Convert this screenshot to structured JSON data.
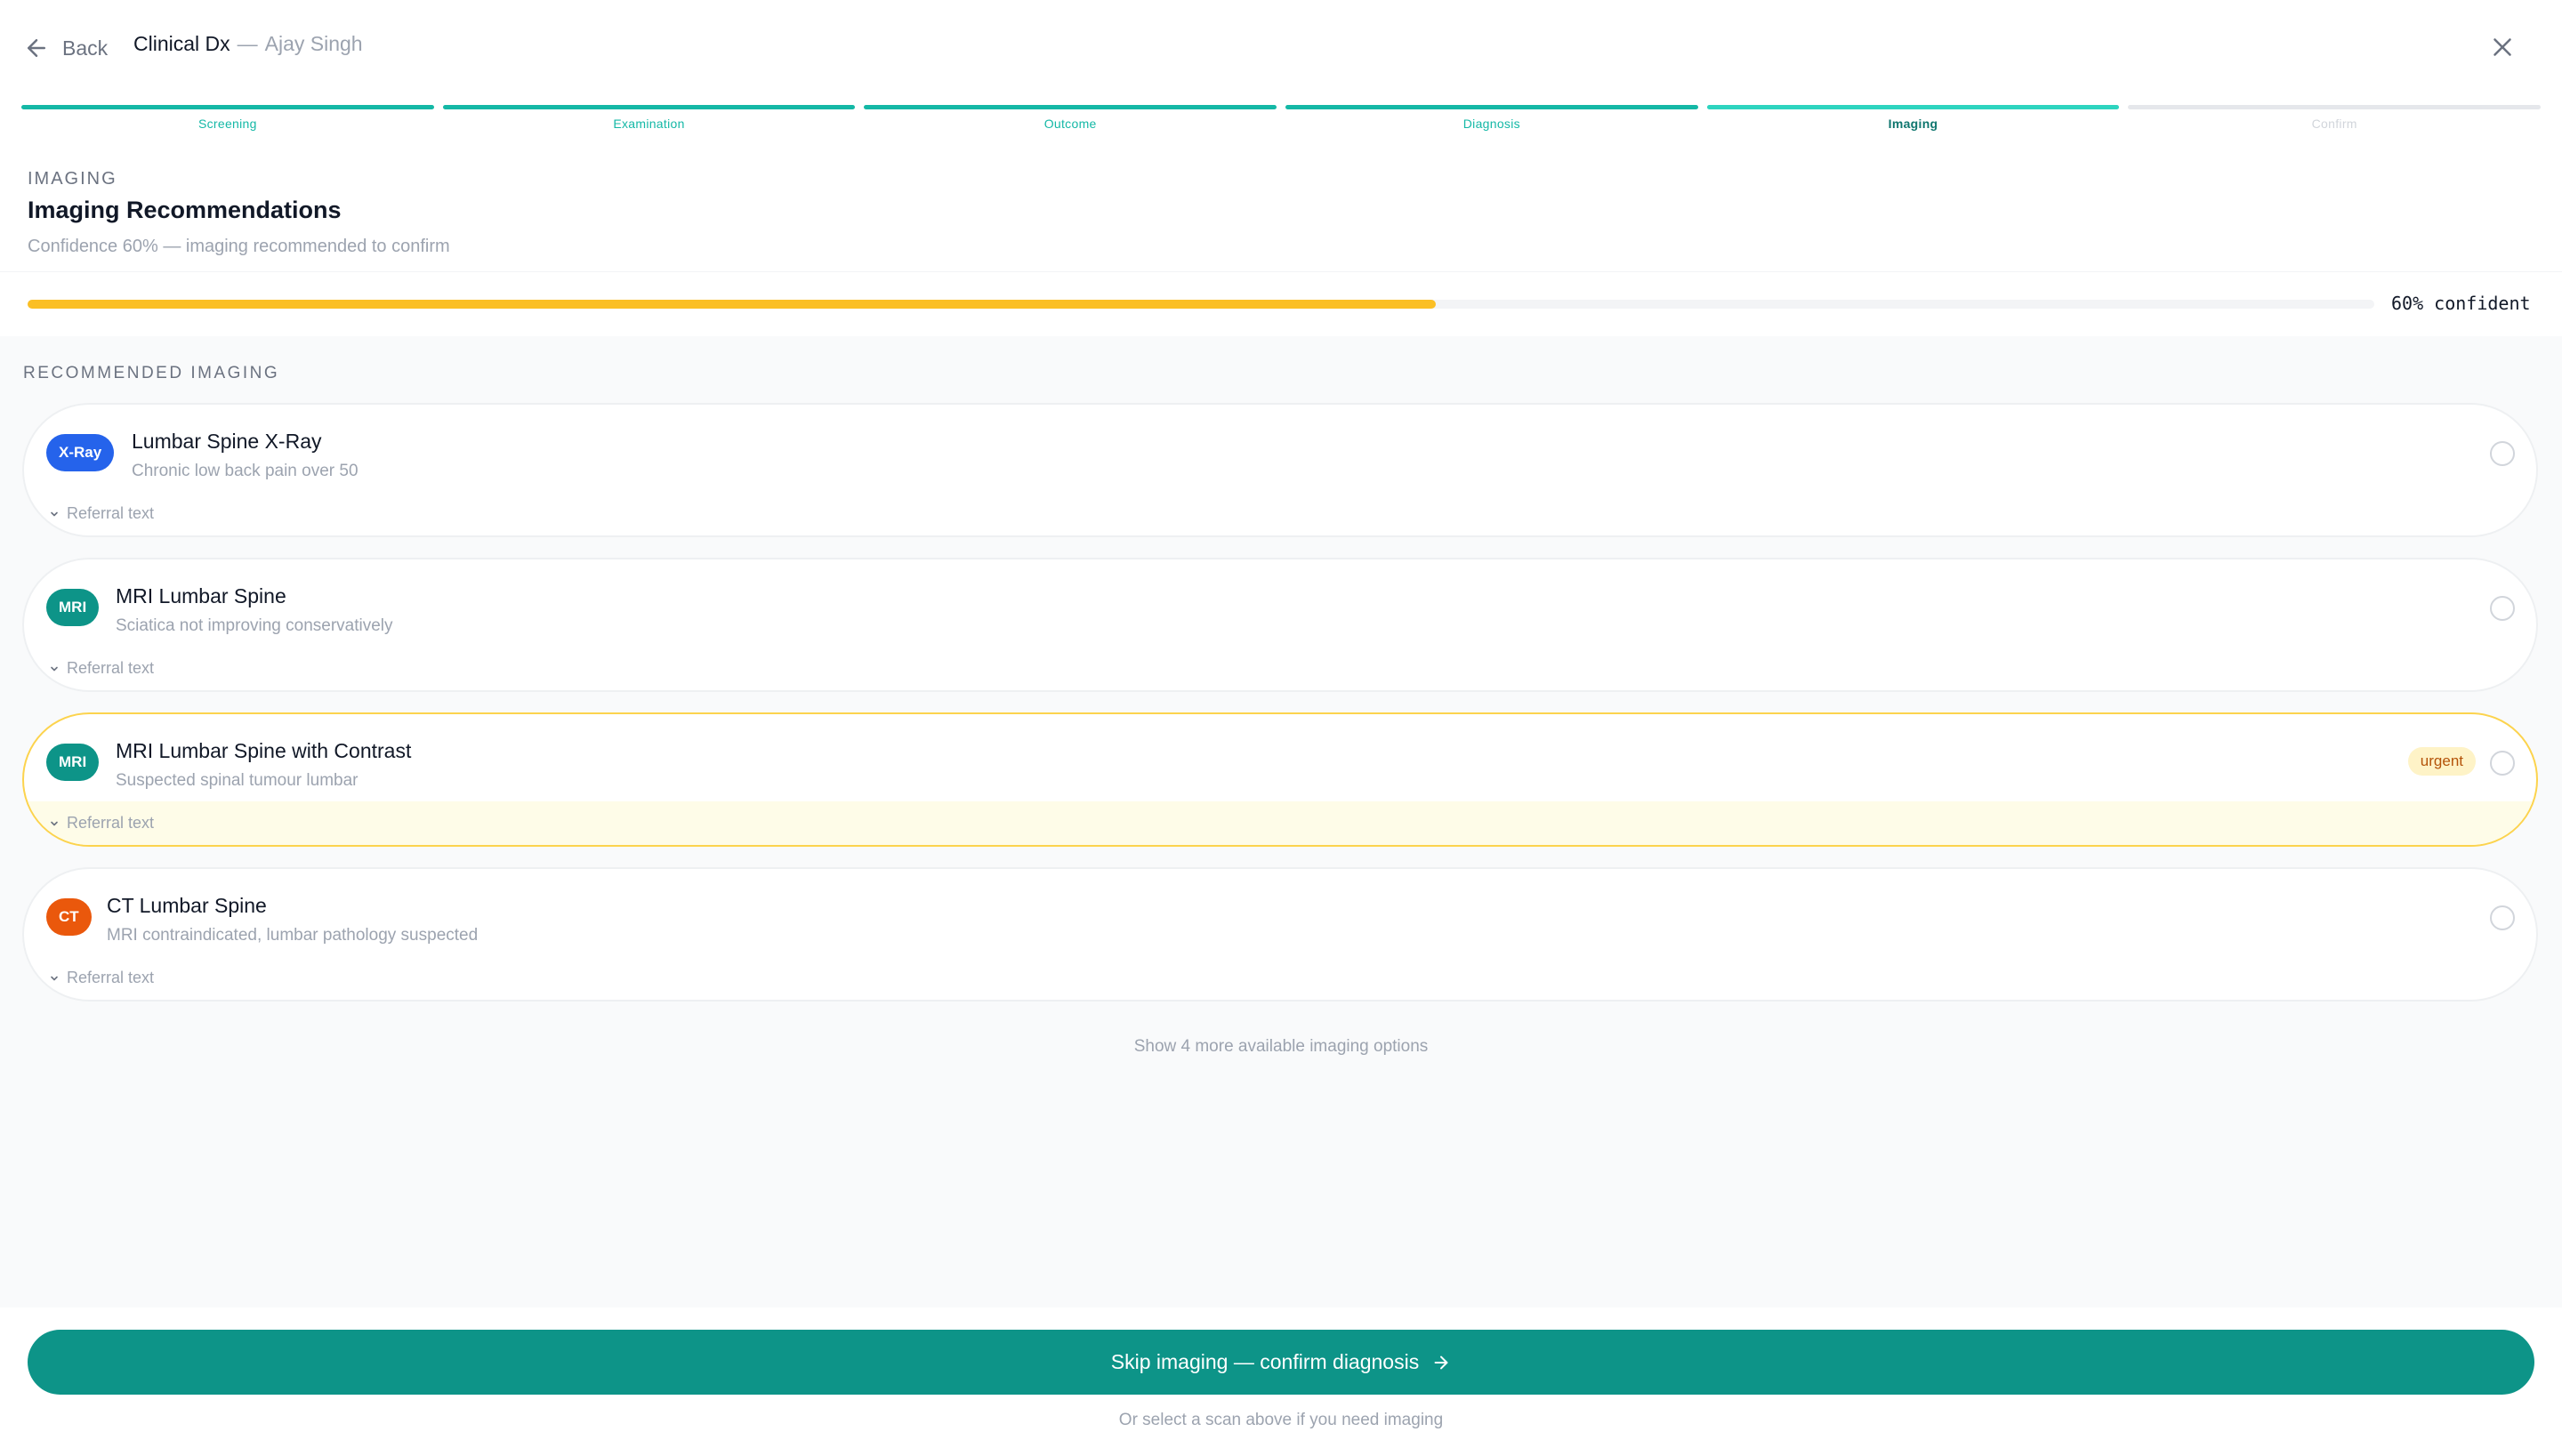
{
  "header": {
    "back_label": "Back",
    "app_title": "Clinical Dx",
    "separator": "—",
    "patient_name": "Ajay Singh"
  },
  "steps": [
    {
      "label": "Screening",
      "state": "done"
    },
    {
      "label": "Examination",
      "state": "done"
    },
    {
      "label": "Outcome",
      "state": "done"
    },
    {
      "label": "Diagnosis",
      "state": "done"
    },
    {
      "label": "Imaging",
      "state": "current"
    },
    {
      "label": "Confirm",
      "state": "future"
    }
  ],
  "section": {
    "eyebrow": "IMAGING",
    "title": "Imaging Recommendations",
    "subtitle": "Confidence 60% — imaging recommended to confirm"
  },
  "confidence": {
    "value": 0.6,
    "label": "60% confident",
    "color": "#fbbf24"
  },
  "recommended_label": "RECOMMENDED IMAGING",
  "imaging": [
    {
      "badge": "X-Ray",
      "badge_color": "#2563eb",
      "name": "Lumbar Spine X-Ray",
      "desc": "Chronic low back pain over 50",
      "referral": "Referral text",
      "urgent": false
    },
    {
      "badge": "MRI",
      "badge_color": "#0d9488",
      "name": "MRI Lumbar Spine",
      "desc": "Sciatica not improving conservatively",
      "referral": "Referral text",
      "urgent": false
    },
    {
      "badge": "MRI",
      "badge_color": "#0d9488",
      "name": "MRI Lumbar Spine with Contrast",
      "desc": "Suspected spinal tumour lumbar",
      "referral": "Referral text",
      "urgent": true,
      "urgent_label": "urgent"
    },
    {
      "badge": "CT",
      "badge_color": "#ea580c",
      "name": "CT Lumbar Spine",
      "desc": "MRI contraindicated, lumbar pathology suspected",
      "referral": "Referral text",
      "urgent": false
    }
  ],
  "more_options": "Show 4 more available imaging options",
  "footer": {
    "cta_label": "Skip imaging — confirm diagnosis",
    "hint": "Or select a scan above if you need imaging",
    "accent": "#0d9488"
  }
}
